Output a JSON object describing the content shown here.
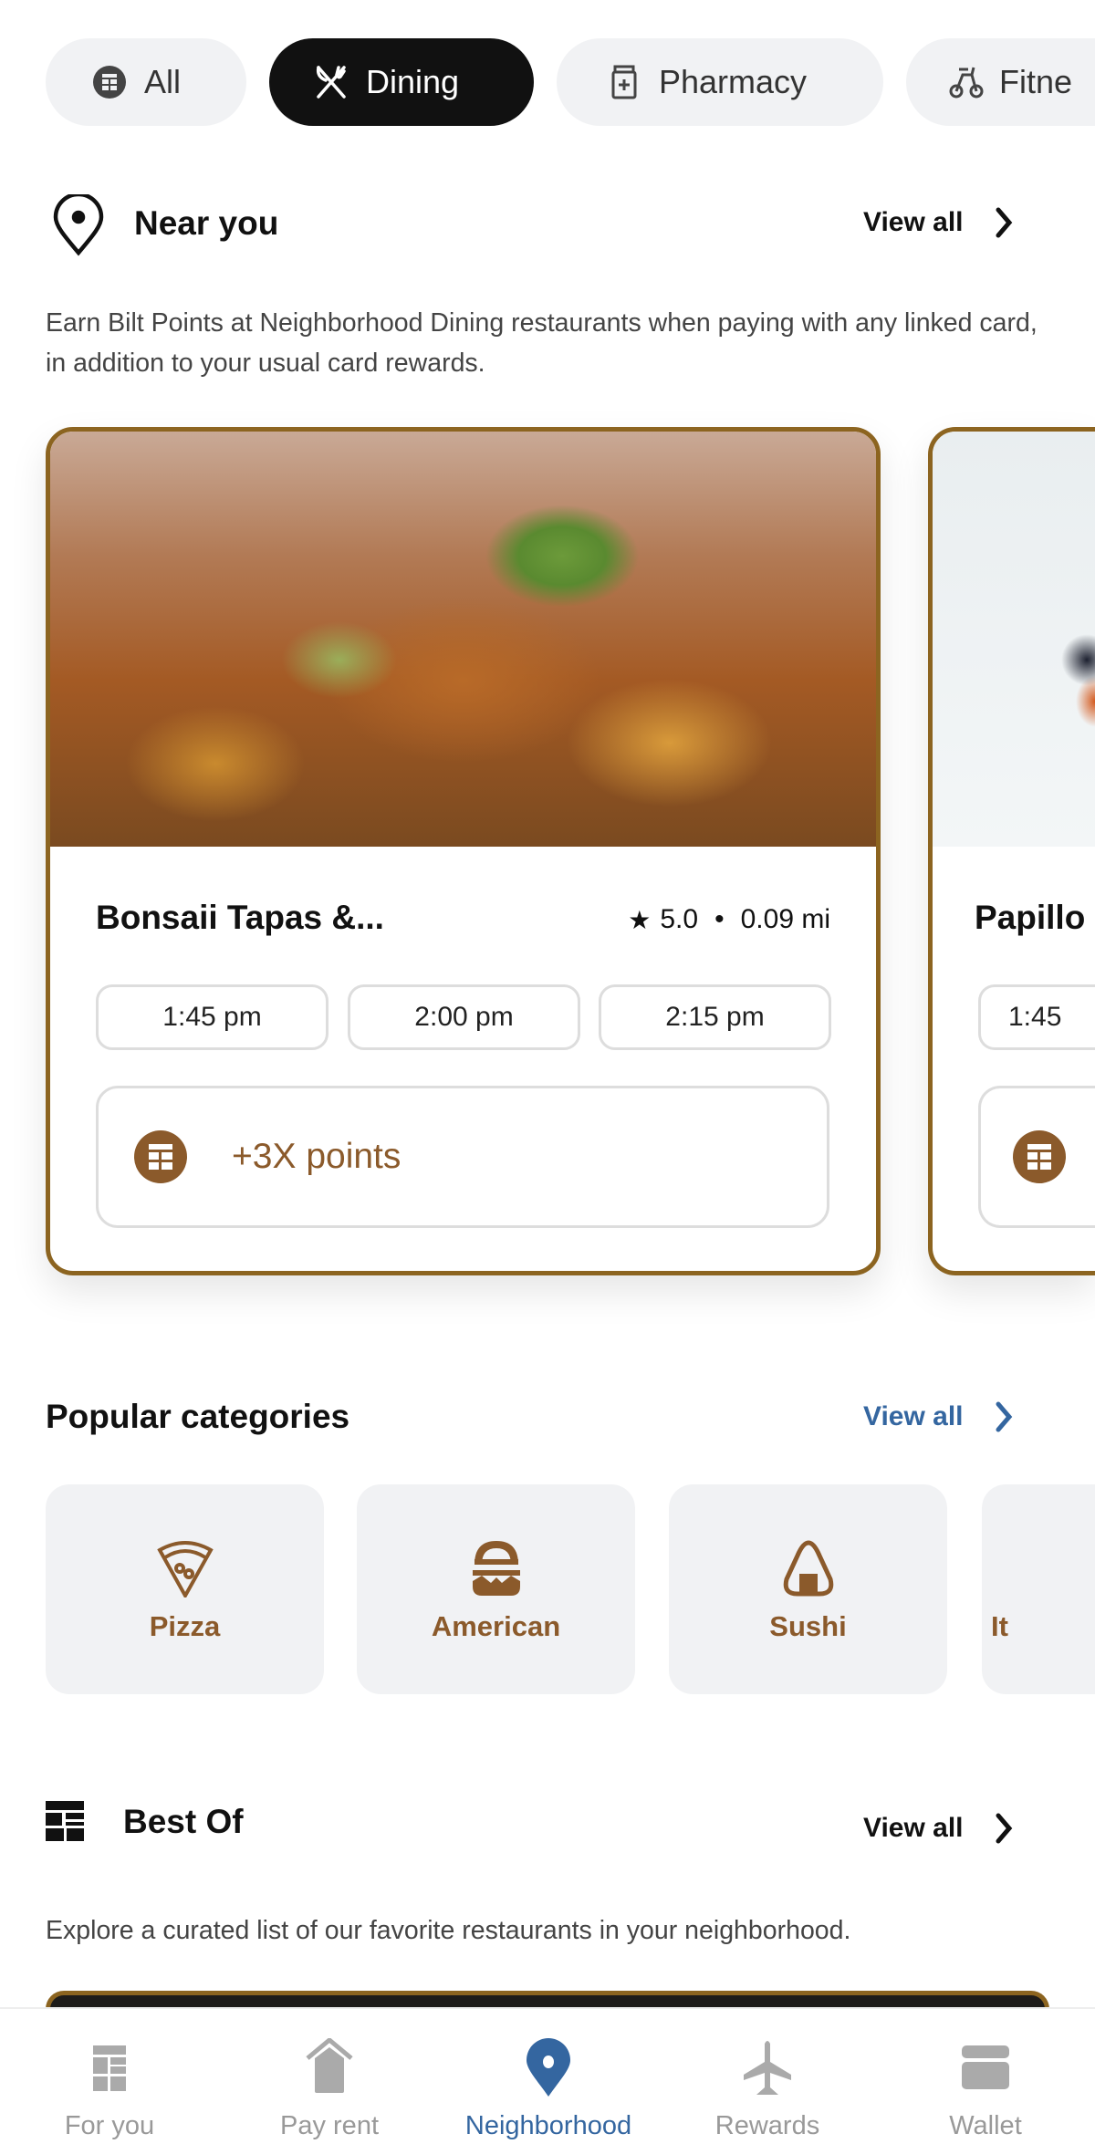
{
  "filters": [
    {
      "label": "All",
      "icon": "bilt-logo-icon",
      "active": false
    },
    {
      "label": "Dining",
      "icon": "fork-knife-icon",
      "active": true
    },
    {
      "label": "Pharmacy",
      "icon": "pill-bottle-icon",
      "active": false
    },
    {
      "label": "Fitne",
      "icon": "bike-icon",
      "active": false
    }
  ],
  "near_you": {
    "title": "Near you",
    "view_all": "View all",
    "description": "Earn Bilt Points at Neighborhood Dining restaurants when paying with any linked card, in addition to your usual card rewards.",
    "cards": [
      {
        "name": "Bonsaii Tapas &...",
        "rating": "5.0",
        "separator": "•",
        "distance": "0.09 mi",
        "times": [
          "1:45 pm",
          "2:00 pm",
          "2:15 pm"
        ],
        "points": "+3X points"
      },
      {
        "name": "Papillo",
        "times": [
          "1:45"
        ]
      }
    ]
  },
  "popular": {
    "title": "Popular categories",
    "view_all": "View all",
    "categories": [
      "Pizza",
      "American",
      "Sushi",
      "It"
    ]
  },
  "best_of": {
    "title": "Best Of",
    "view_all": "View all",
    "description": "Explore a curated list of our favorite restaurants in your neighborhood."
  },
  "nav": [
    {
      "label": "For you",
      "icon": "bilt-logo-icon"
    },
    {
      "label": "Pay rent",
      "icon": "house-icon"
    },
    {
      "label": "Neighborhood",
      "icon": "location-pin-icon",
      "active": true
    },
    {
      "label": "Rewards",
      "icon": "airplane-icon"
    },
    {
      "label": "Wallet",
      "icon": "wallet-icon"
    }
  ],
  "colors": {
    "accent_brown": "#8b5a2b",
    "card_border": "#8c6420",
    "link_blue": "#3466a0",
    "chip_bg": "#f1f2f4"
  }
}
